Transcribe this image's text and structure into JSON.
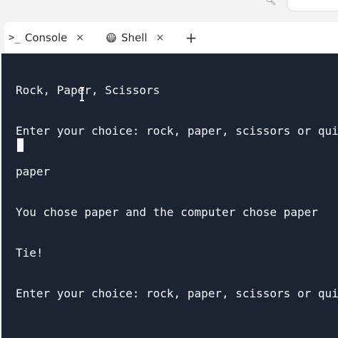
{
  "tabs": [
    {
      "label": "Console",
      "icon": "terminal-prompt-icon",
      "close": "×"
    },
    {
      "label": "Shell",
      "icon": "shell-icon",
      "close": "×"
    }
  ],
  "add_tab_label": "+",
  "console": {
    "lines": [
      "Rock, Paper, Scissors",
      "Enter your choice: rock, paper, scissors or quit",
      "paper",
      "You chose paper and the computer chose paper",
      "Tie!",
      "Enter your choice: rock, paper, scissors or quit"
    ]
  },
  "colors": {
    "console_bg": "#1c2333",
    "console_text": "#f5f7fa",
    "tabbar_bg": "#ffffff"
  }
}
